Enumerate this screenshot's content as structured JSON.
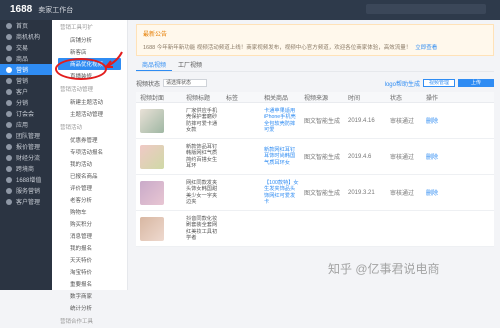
{
  "topbar": {
    "brand": "1688",
    "brand_sub": "卖家工作台"
  },
  "leftnav": {
    "items": [
      {
        "label": "首页"
      },
      {
        "label": "商机机构"
      },
      {
        "label": "交易"
      },
      {
        "label": "商品"
      },
      {
        "label": "营销"
      },
      {
        "label": "营销"
      },
      {
        "label": "客户"
      },
      {
        "label": "分销"
      },
      {
        "label": "订会会"
      },
      {
        "label": "应用"
      },
      {
        "label": "团队管理"
      },
      {
        "label": "报价管理"
      },
      {
        "label": "财经分流"
      },
      {
        "label": "跨境商"
      },
      {
        "label": "1688增值"
      },
      {
        "label": "服务营销"
      },
      {
        "label": "客户管理"
      }
    ]
  },
  "subnav": {
    "items": [
      {
        "kind": "group",
        "label": "营销工具可扩"
      },
      {
        "kind": "link",
        "label": "店铺分析"
      },
      {
        "kind": "link",
        "label": "新客店"
      },
      {
        "kind": "link",
        "label": "商品优化视频",
        "selected": true
      },
      {
        "kind": "link",
        "label": "直播装修"
      },
      {
        "kind": "group",
        "label": "营销活动管理"
      },
      {
        "kind": "link",
        "label": "新建主题活动"
      },
      {
        "kind": "link",
        "label": "主题活动管理"
      },
      {
        "kind": "group",
        "label": "营销活动"
      },
      {
        "kind": "link",
        "label": "优惠券管理"
      },
      {
        "kind": "link",
        "label": "专项活动报名"
      },
      {
        "kind": "link",
        "label": "我的活动"
      },
      {
        "kind": "link",
        "label": "已报名商品"
      },
      {
        "kind": "link",
        "label": "评价管理"
      },
      {
        "kind": "link",
        "label": "老客分析"
      },
      {
        "kind": "link",
        "label": "购物车"
      },
      {
        "kind": "link",
        "label": "购买积分"
      },
      {
        "kind": "link",
        "label": "消息管理"
      },
      {
        "kind": "link",
        "label": "我的报名"
      },
      {
        "kind": "link",
        "label": "天天特价"
      },
      {
        "kind": "link",
        "label": "淘宝特价"
      },
      {
        "kind": "link",
        "label": "重要报名"
      },
      {
        "kind": "link",
        "label": "数字商家"
      },
      {
        "kind": "link",
        "label": "统计分析"
      },
      {
        "kind": "group",
        "label": "营销合作工具"
      }
    ]
  },
  "notice": {
    "title": "最新公告",
    "body": "1688 今年新年新功能 视频活动频道上线！商家视频发布，视频中心官方频道，欢迎各位商家体验，高效流量！",
    "link": "立即查看"
  },
  "tabs": [
    {
      "label": "商品视频",
      "active": true
    },
    {
      "label": "工厂视频",
      "active": false
    }
  ],
  "filters": {
    "label": "视频状态",
    "select": "请选择状态",
    "link": "logo帮助生成",
    "btn1": "视频管理",
    "btn2": "上传"
  },
  "table": {
    "headers": [
      "视频封面",
      "视频标题",
      "标签",
      "相关商品",
      "视频来源",
      "时间",
      "状态",
      "操作"
    ],
    "rows": [
      {
        "colors": [
          "#e9e1d7",
          "#9fb7a3"
        ],
        "title": "厂家供应手机壳保护套磨砂防摔可爱卡通女款",
        "tag": "",
        "goods": "卡通苹果适用iPhone手机壳全包软壳防摔可爱",
        "source": "图文智能生成",
        "time": "2019.4.16",
        "status": "审核通过",
        "action": "删除"
      },
      {
        "colors": [
          "#f0c9c6",
          "#cfd9a6"
        ],
        "title": "新款饰品耳钉韩版网红气质简约百搭女生耳环",
        "tag": "",
        "goods": "新款网红耳钉耳饰时尚韩国气质耳环女",
        "source": "图文智能生成",
        "time": "2019.4.6",
        "status": "审核通过",
        "action": "删除"
      },
      {
        "colors": [
          "#c9aac9",
          "#e8c6d3"
        ],
        "title": "网红同款发夹头饰女韩国甜美少女一字夹边夹",
        "tag": "",
        "goods": "【100款特】女生发夹饰品头饰网红可爱发卡",
        "source": "图文智能生成",
        "time": "2019.3.21",
        "status": "审核通过",
        "action": "删除"
      },
      {
        "colors": [
          "#d8b7a2",
          "#eed9cf"
        ],
        "title": "抖音同款化妆刷套装全套网红美妆工具初学者",
        "tag": "",
        "goods": "",
        "source": "",
        "time": "",
        "status": "",
        "action": ""
      }
    ]
  },
  "watermark": "知乎 @亿事君说电商",
  "colors": {
    "accent": "#2f8cf3",
    "annotation": "#e21d1d",
    "nav_bg": "#2b3442"
  }
}
